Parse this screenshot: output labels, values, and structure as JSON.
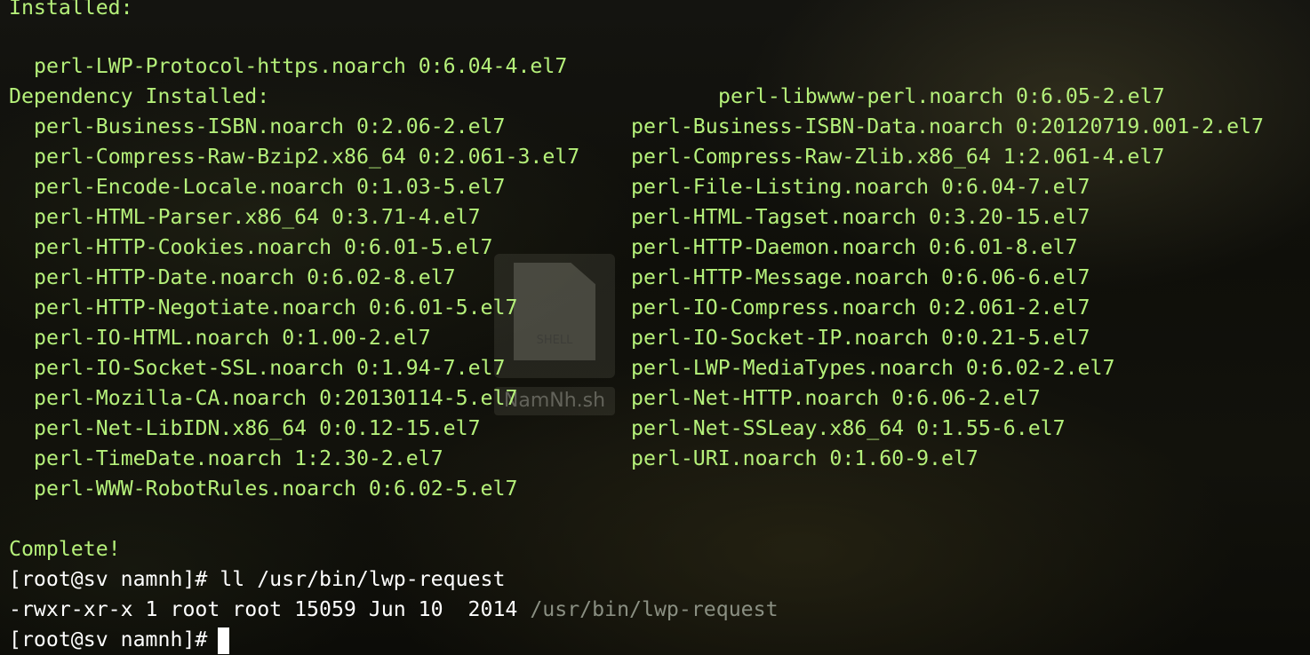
{
  "terminal": {
    "installed_header": "Installed:",
    "installed": [
      "perl-LWP-Protocol-https.noarch 0:6.04-4.el7",
      "perl-libwww-perl.noarch 0:6.05-2.el7"
    ],
    "dependency_header": "Dependency Installed:",
    "dependencies": [
      [
        "perl-Business-ISBN.noarch 0:2.06-2.el7",
        "perl-Business-ISBN-Data.noarch 0:20120719.001-2.el7"
      ],
      [
        "perl-Compress-Raw-Bzip2.x86_64 0:2.061-3.el7",
        "perl-Compress-Raw-Zlib.x86_64 1:2.061-4.el7"
      ],
      [
        "perl-Encode-Locale.noarch 0:1.03-5.el7",
        "perl-File-Listing.noarch 0:6.04-7.el7"
      ],
      [
        "perl-HTML-Parser.x86_64 0:3.71-4.el7",
        "perl-HTML-Tagset.noarch 0:3.20-15.el7"
      ],
      [
        "perl-HTTP-Cookies.noarch 0:6.01-5.el7",
        "perl-HTTP-Daemon.noarch 0:6.01-8.el7"
      ],
      [
        "perl-HTTP-Date.noarch 0:6.02-8.el7",
        "perl-HTTP-Message.noarch 0:6.06-6.el7"
      ],
      [
        "perl-HTTP-Negotiate.noarch 0:6.01-5.el7",
        "perl-IO-Compress.noarch 0:2.061-2.el7"
      ],
      [
        "perl-IO-HTML.noarch 0:1.00-2.el7",
        "perl-IO-Socket-IP.noarch 0:0.21-5.el7"
      ],
      [
        "perl-IO-Socket-SSL.noarch 0:1.94-7.el7",
        "perl-LWP-MediaTypes.noarch 0:6.02-2.el7"
      ],
      [
        "perl-Mozilla-CA.noarch 0:20130114-5.el7",
        "perl-Net-HTTP.noarch 0:6.06-2.el7"
      ],
      [
        "perl-Net-LibIDN.x86_64 0:0.12-15.el7",
        "perl-Net-SSLeay.x86_64 0:1.55-6.el7"
      ],
      [
        "perl-TimeDate.noarch 1:2.30-2.el7",
        "perl-URI.noarch 0:1.60-9.el7"
      ],
      [
        "perl-WWW-RobotRules.noarch 0:6.02-5.el7",
        ""
      ]
    ],
    "complete": "Complete!",
    "prompt": "[root@sv namnh]#",
    "command": "ll /usr/bin/lwp-request",
    "ls_output_prefix": "-rwxr-xr-x 1 root root 15059 Jun 10  2014",
    "ls_output_path": "/usr/bin/lwp-request"
  },
  "watermark": {
    "doc_label": "SHELL",
    "name": "NamNh.sh"
  },
  "colors": {
    "text_green": "#b5f07a",
    "text_white": "#ffffff",
    "path_gray": "#8a8f82",
    "background": "#0d0d08"
  }
}
